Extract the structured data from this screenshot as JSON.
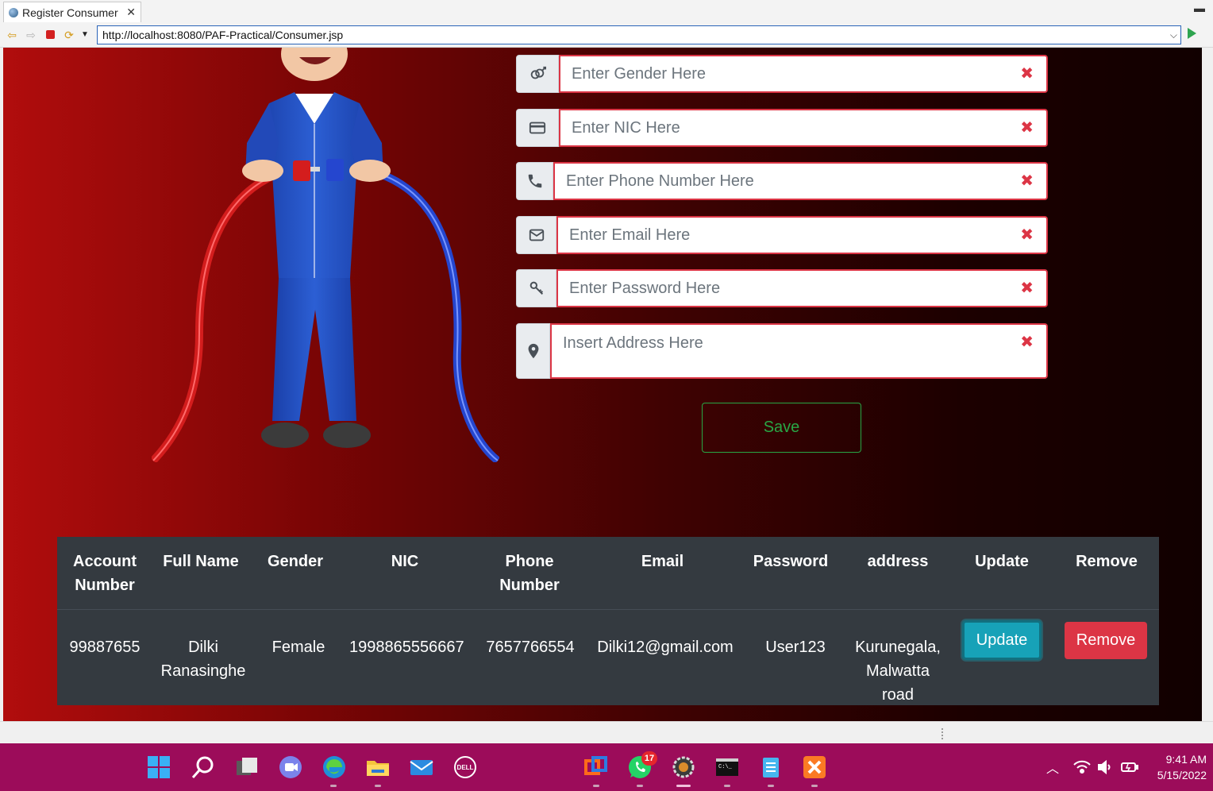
{
  "browser": {
    "tab_title": "Register Consumer",
    "url": "http://localhost:8080/PAF-Practical/Consumer.jsp"
  },
  "form": {
    "gender_placeholder": "Enter Gender Here",
    "nic_placeholder": "Enter NIC Here",
    "phone_placeholder": "Enter Phone Number Here",
    "email_placeholder": "Enter Email Here",
    "password_placeholder": "Enter Password Here",
    "address_placeholder": "Insert Address Here",
    "clear_glyph": "✖",
    "save_label": "Save"
  },
  "table": {
    "headers": {
      "account_1": "Account",
      "account_2": "Number",
      "full_name": "Full Name",
      "gender": "Gender",
      "nic": "NIC",
      "phone_1": "Phone",
      "phone_2": "Number",
      "email": "Email",
      "password": "Password",
      "address": "address",
      "update": "Update",
      "remove": "Remove"
    },
    "rows": [
      {
        "account_number": "99887655",
        "full_name_1": "Dilki",
        "full_name_2": "Ranasinghe",
        "gender": "Female",
        "nic": "1998865556667",
        "phone": "7657766554",
        "email": "Dilki12@gmail.com",
        "password": "User123",
        "address_1": "Kurunegala,",
        "address_2": "Malwatta",
        "address_3": "road",
        "update_label": "Update",
        "remove_label": "Remove"
      }
    ]
  },
  "taskbar": {
    "icons": [
      "windows-start-icon",
      "search-icon",
      "task-view-icon",
      "teams-chat-icon",
      "edge-icon",
      "file-explorer-icon",
      "mail-icon",
      "dell-icon",
      "office-icon",
      "whatsapp-icon",
      "eclipse-ide-icon",
      "terminal-icon",
      "notepad-icon",
      "xampp-icon"
    ],
    "whatsapp_badge": "17",
    "time": "9:41 AM",
    "date": "5/15/2022"
  },
  "colors": {
    "danger": "#dc3545",
    "success": "#28a745",
    "info": "#17a2b8",
    "table_dark": "#343a40",
    "taskbar": "#9c0c5a"
  }
}
